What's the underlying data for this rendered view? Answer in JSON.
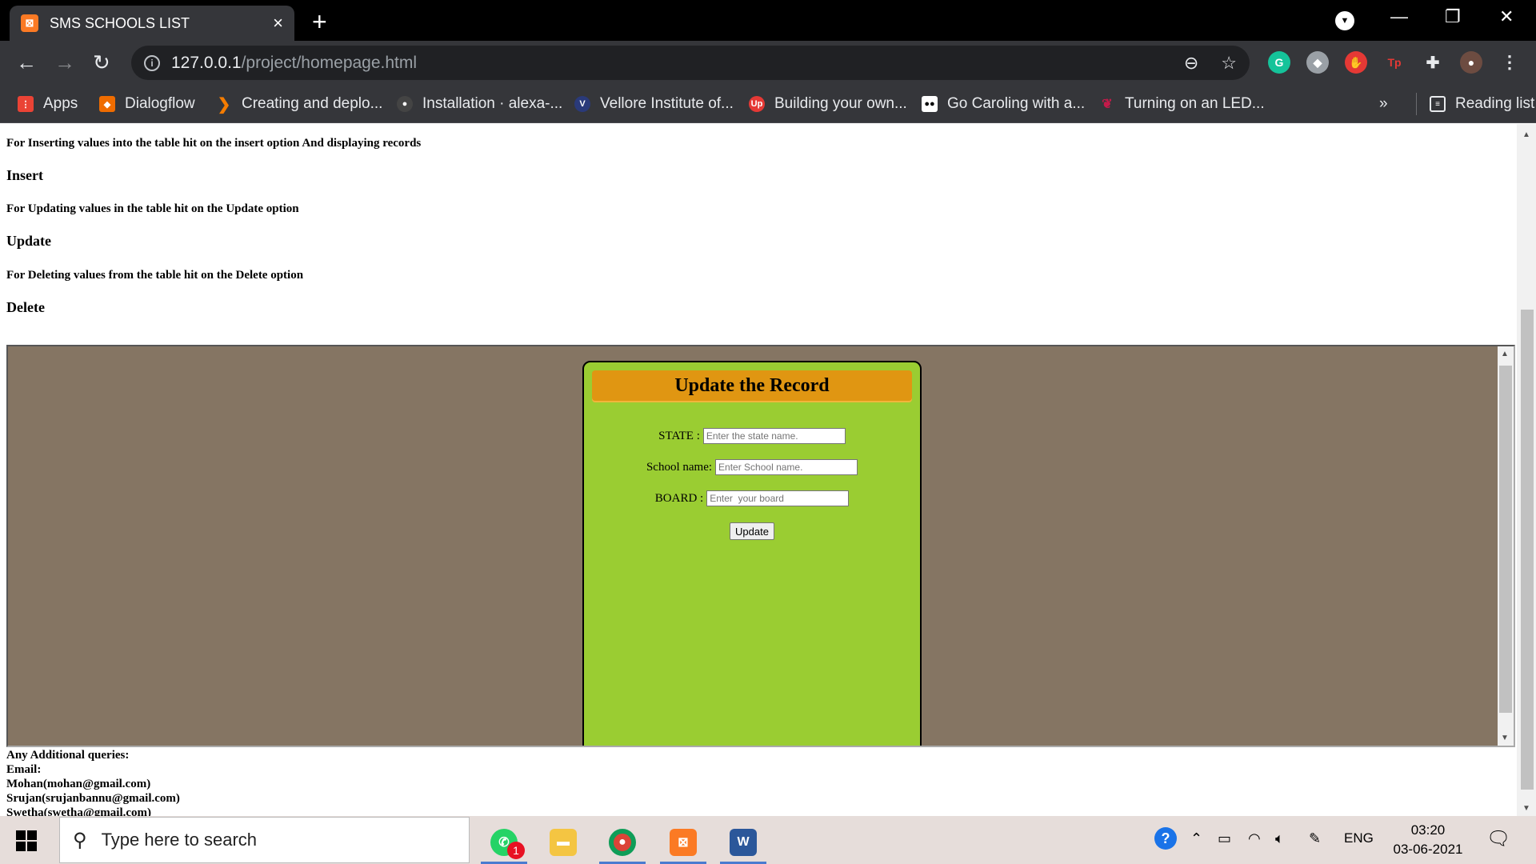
{
  "browser": {
    "tab_title": "SMS SCHOOLS LIST",
    "tab_favicon": "xampp-icon",
    "new_tab": "+",
    "url_host": "127.0.0.1",
    "url_path": "/project/homepage.html",
    "bookmarks": [
      {
        "label": "Apps",
        "icon": "apps-grid-icon",
        "color": "#ea4335"
      },
      {
        "label": "Dialogflow",
        "icon": "dialogflow-icon",
        "color": "#ef6c00"
      },
      {
        "label": "Creating and deplo...",
        "icon": "chevron-icon",
        "color": "#f57c00"
      },
      {
        "label": "Installation · alexa-...",
        "icon": "github-icon",
        "color": "#444"
      },
      {
        "label": "Vellore Institute of...",
        "icon": "vit-icon",
        "color": "#2a3a7a"
      },
      {
        "label": "Building your own...",
        "icon": "upgrad-icon",
        "color": "#e53935"
      },
      {
        "label": "Go Caroling with a...",
        "icon": "medium-icon",
        "color": "#000"
      },
      {
        "label": "Turning on an LED...",
        "icon": "raspberry-icon",
        "color": "#c51a4a"
      }
    ],
    "more_bookmarks": "»",
    "reading_list": "Reading list"
  },
  "page": {
    "instructions": [
      {
        "text": "For Inserting values into the table hit on the insert option And displaying records",
        "op": "Insert"
      },
      {
        "text": "For Updating values in the table hit on the Update option",
        "op": "Update"
      },
      {
        "text": "For Deleting values from the table hit on the Delete option",
        "op": "Delete"
      }
    ],
    "form": {
      "title": "Update the Record",
      "state_label": "STATE :",
      "state_placeholder": "Enter the state name.",
      "school_label": "School name:",
      "school_placeholder": "Enter School name.",
      "board_label": "BOARD :",
      "board_placeholder": "Enter  your board",
      "submit_label": "Update"
    },
    "footer": {
      "queries": "Any Additional queries:",
      "email_label": "Email:",
      "contacts": [
        "Mohan(mohan@gmail.com)",
        "Srujan(srujanbannu@gmail.com)",
        "Swetha(swetha@gmail.com)"
      ]
    }
  },
  "taskbar": {
    "search_placeholder": "Type here to search",
    "whatsapp_badge": "1",
    "language": "ENG",
    "time": "03:20",
    "date": "03-06-2021"
  },
  "colors": {
    "iframe_bg": "#857563",
    "card_bg": "#9acd32",
    "card_title_bg": "#e09612"
  }
}
